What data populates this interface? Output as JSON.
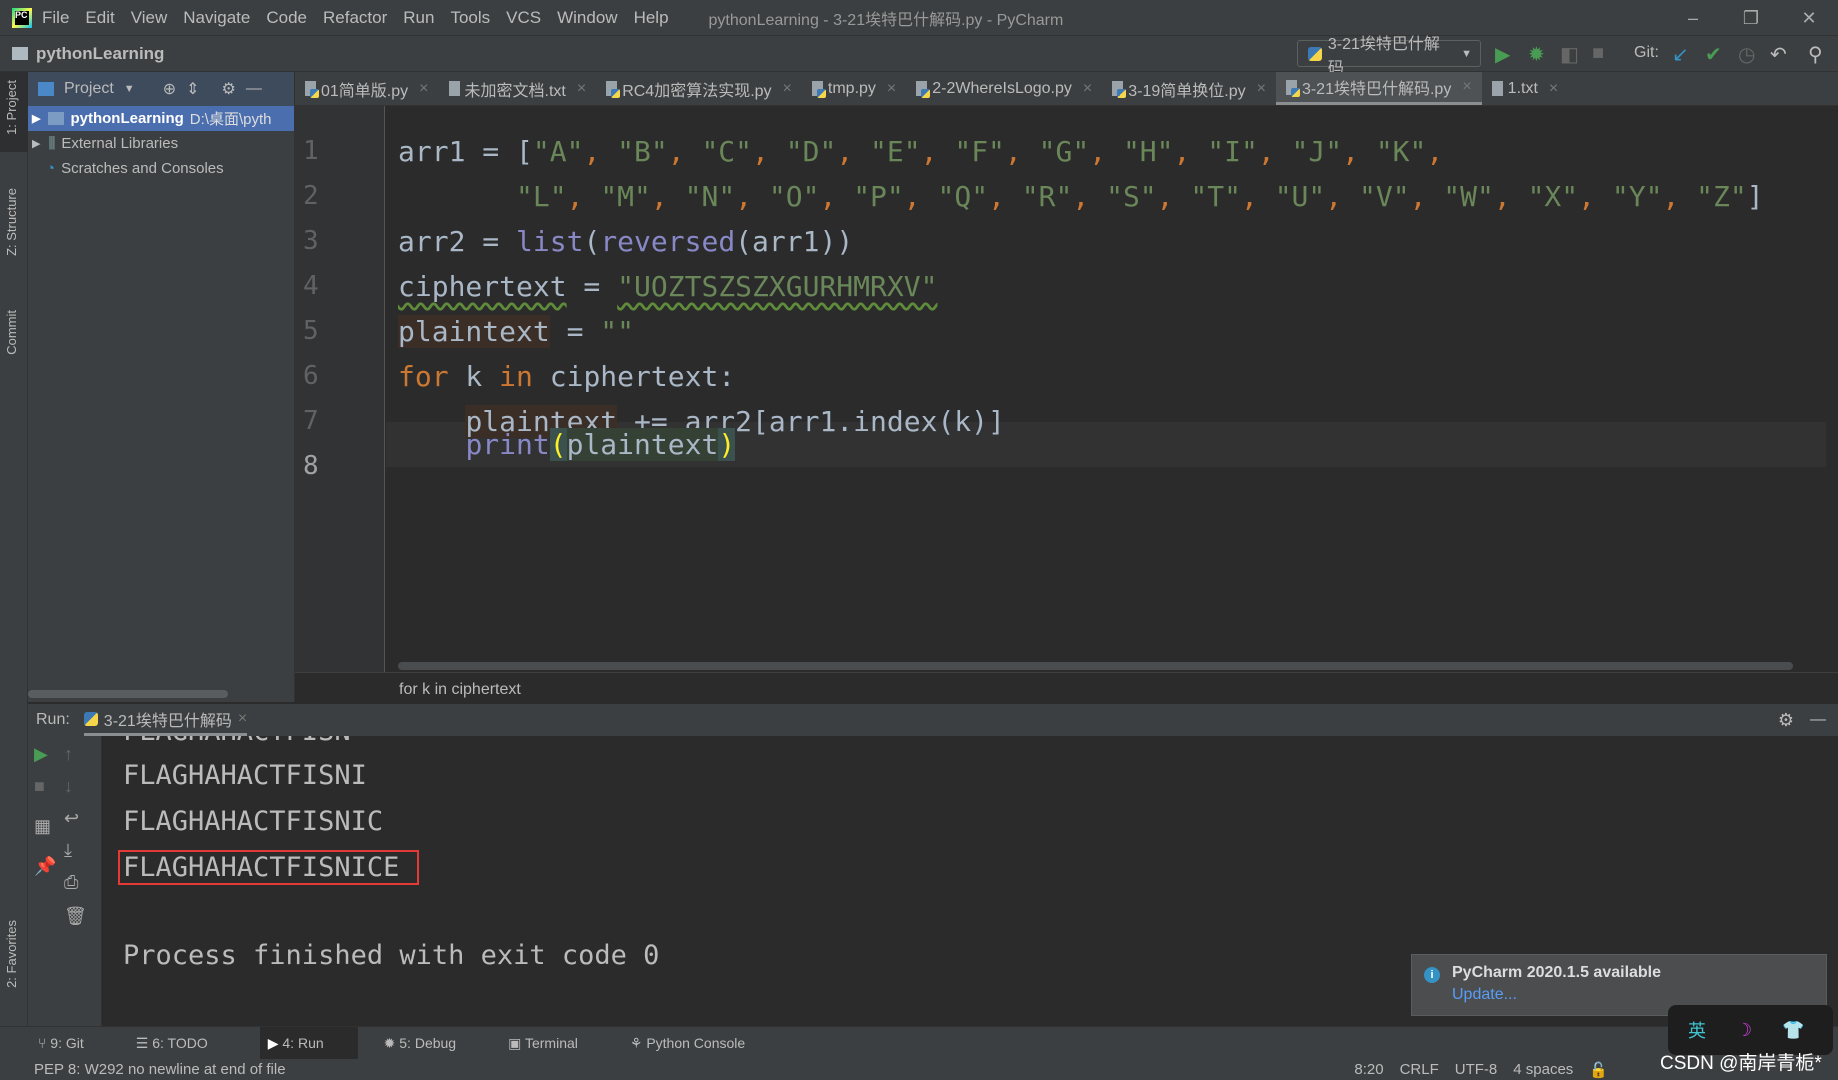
{
  "app": {
    "logo_text": "PC",
    "title": "pythonLearning - 3-21埃特巴什解码.py - PyCharm"
  },
  "menu": [
    "File",
    "Edit",
    "View",
    "Navigate",
    "Code",
    "Refactor",
    "Run",
    "Tools",
    "VCS",
    "Window",
    "Help"
  ],
  "window_controls": {
    "minimize": "–",
    "restore": "❐",
    "close": "✕"
  },
  "navbar": {
    "project": "pythonLearning",
    "run_config": "3-21埃特巴什解码",
    "git_label": "Git:"
  },
  "left_strip": {
    "project": "1: Project",
    "structure": "Z: Structure",
    "commit": "Commit",
    "favorites": "2: Favorites"
  },
  "project_panel": {
    "title": "Project",
    "tree": [
      {
        "label": "pythonLearning",
        "path": "D:\\桌面\\pyth"
      },
      {
        "label": "External Libraries"
      },
      {
        "label": "Scratches and Consoles"
      }
    ]
  },
  "tabs": [
    {
      "label": "01简单版.py",
      "type": "py"
    },
    {
      "label": "未加密文档.txt",
      "type": "txt"
    },
    {
      "label": "RC4加密算法实现.py",
      "type": "py"
    },
    {
      "label": "tmp.py",
      "type": "py"
    },
    {
      "label": "2-2WhereIsLogo.py",
      "type": "py"
    },
    {
      "label": "3-19简单换位.py",
      "type": "py"
    },
    {
      "label": "3-21埃特巴什解码.py",
      "type": "py",
      "active": true
    },
    {
      "label": "1.txt",
      "type": "txt"
    }
  ],
  "editor": {
    "line_numbers": [
      "1",
      "2",
      "3",
      "4",
      "5",
      "6",
      "7",
      "8"
    ],
    "breadcrumb": "for k in ciphertext",
    "line1_a": "arr1 = [",
    "line1_items": [
      "\"A\"",
      "\"B\"",
      "\"C\"",
      "\"D\"",
      "\"E\"",
      "\"F\"",
      "\"G\"",
      "\"H\"",
      "\"I\"",
      "\"J\"",
      "\"K\""
    ],
    "line2_items": [
      "\"L\"",
      "\"M\"",
      "\"N\"",
      "\"O\"",
      "\"P\"",
      "\"Q\"",
      "\"R\"",
      "\"S\"",
      "\"T\"",
      "\"U\"",
      "\"V\"",
      "\"W\"",
      "\"X\"",
      "\"Y\"",
      "\"Z\""
    ],
    "line3": {
      "a": "arr2 = ",
      "list": "list",
      "p1": "(",
      "rev": "reversed",
      "rest": "(arr1))"
    },
    "line4": {
      "var": "ciphertext",
      "eq": " = ",
      "str": "\"UOZTSZSZXGURHMRXV\""
    },
    "line5": {
      "var": "plaintext",
      "eq": " = ",
      "str": "\"\""
    },
    "line6": {
      "for": "for",
      "k": " k ",
      "in": "in",
      "rest": " ciphertext:"
    },
    "line7": {
      "var": "plaintext",
      "rest": " += arr2[arr1.index(k)]"
    },
    "line8": {
      "print": "print",
      "p1": "(",
      "arg": "plaintext",
      "p2": ")"
    }
  },
  "run": {
    "label": "Run:",
    "tab": "3-21埃特巴什解码",
    "output": [
      "FLAGHAHACTFISN",
      "FLAGHAHACTFISNI",
      "FLAGHAHACTFISNIC",
      "FLAGHAHACTFISNICE",
      "Process finished with exit code 0"
    ]
  },
  "toolwindows": [
    "9: Git",
    "6: TODO",
    "4: Run",
    "5: Debug",
    "Terminal",
    "Python Console"
  ],
  "status": {
    "message": "PEP 8: W292 no newline at end of file",
    "position": "8:20",
    "line_sep": "CRLF",
    "encoding": "UTF-8",
    "indent": "4 spaces"
  },
  "notification": {
    "title": "PyCharm 2020.1.5 available",
    "link": "Update..."
  },
  "watermark": "CSDN @南岸青栀*",
  "ime": {
    "lang": "英",
    "moon": "☽",
    "shirt": "👕"
  },
  "colors": {
    "keyword": "#cc7832",
    "string": "#6a8759",
    "builtin": "#8888c6",
    "highlight_box": "#e53935",
    "accent": "#4b6eaf"
  }
}
